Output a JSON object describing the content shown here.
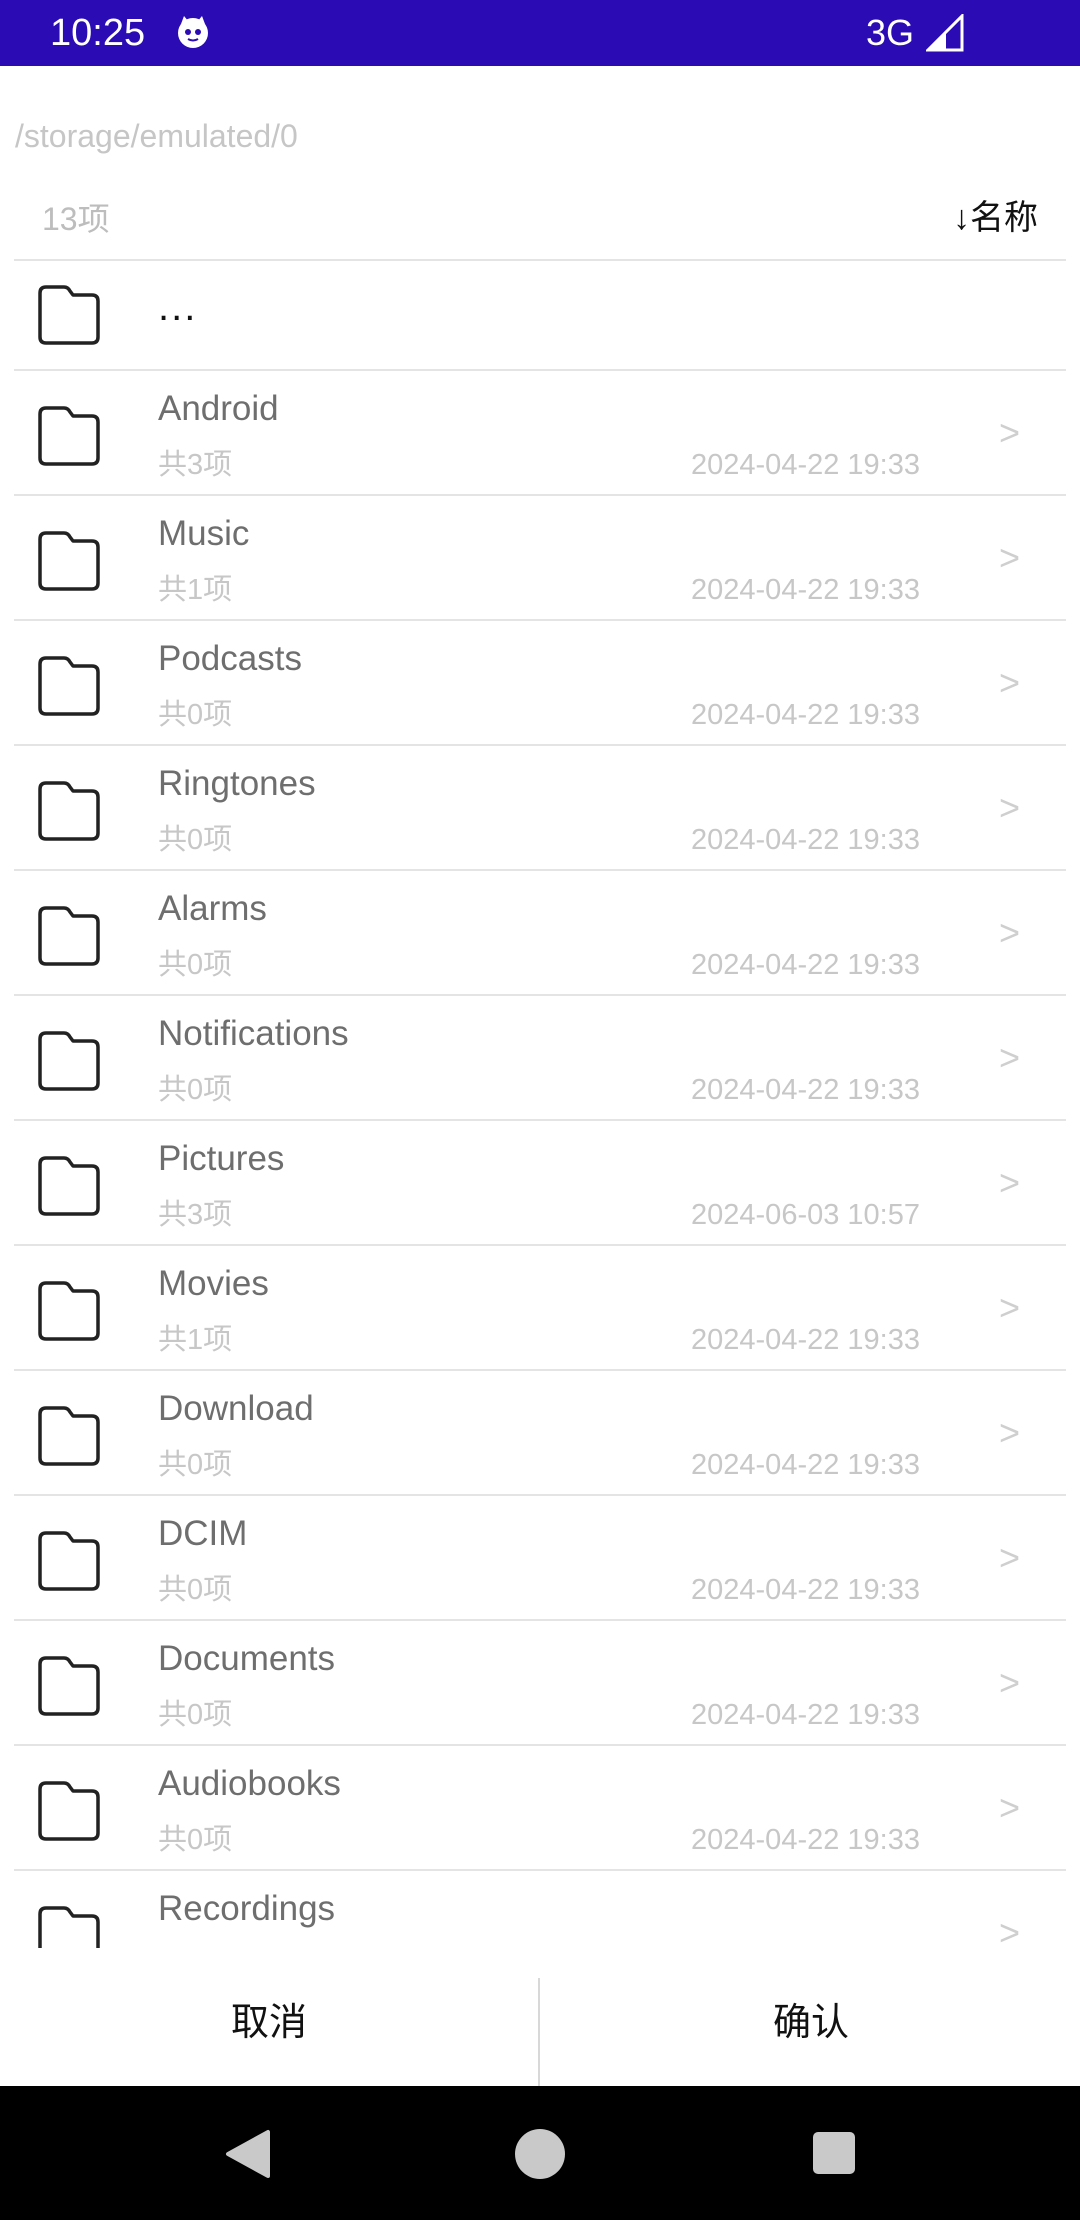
{
  "status_bar": {
    "time": "10:25",
    "network": "3G",
    "app_icon": "cat-face-icon",
    "signal_icon": "signal-icon"
  },
  "path": "/storage/emulated/0",
  "summary": {
    "count": "13项",
    "sort_label": "↓名称"
  },
  "up_item": {
    "label": "...",
    "icon": "folder-icon"
  },
  "folders": [
    {
      "name": "Android",
      "items": "共3项",
      "modified": "2024-04-22 19:33",
      "chevron": ">"
    },
    {
      "name": "Music",
      "items": "共1项",
      "modified": "2024-04-22 19:33",
      "chevron": ">"
    },
    {
      "name": "Podcasts",
      "items": "共0项",
      "modified": "2024-04-22 19:33",
      "chevron": ">"
    },
    {
      "name": "Ringtones",
      "items": "共0项",
      "modified": "2024-04-22 19:33",
      "chevron": ">"
    },
    {
      "name": "Alarms",
      "items": "共0项",
      "modified": "2024-04-22 19:33",
      "chevron": ">"
    },
    {
      "name": "Notifications",
      "items": "共0项",
      "modified": "2024-04-22 19:33",
      "chevron": ">"
    },
    {
      "name": "Pictures",
      "items": "共3项",
      "modified": "2024-06-03 10:57",
      "chevron": ">"
    },
    {
      "name": "Movies",
      "items": "共1项",
      "modified": "2024-04-22 19:33",
      "chevron": ">"
    },
    {
      "name": "Download",
      "items": "共0项",
      "modified": "2024-04-22 19:33",
      "chevron": ">"
    },
    {
      "name": "DCIM",
      "items": "共0项",
      "modified": "2024-04-22 19:33",
      "chevron": ">"
    },
    {
      "name": "Documents",
      "items": "共0项",
      "modified": "2024-04-22 19:33",
      "chevron": ">"
    },
    {
      "name": "Audiobooks",
      "items": "共0项",
      "modified": "2024-04-22 19:33",
      "chevron": ">"
    },
    {
      "name": "Recordings",
      "items": "",
      "modified": "",
      "chevron": ">"
    }
  ],
  "buttons": {
    "cancel": "取消",
    "confirm": "确认"
  },
  "colors": {
    "status_bar": "#2a0bb4",
    "divider": "#e4e4e4",
    "secondary_text": "#c7c7c7"
  }
}
